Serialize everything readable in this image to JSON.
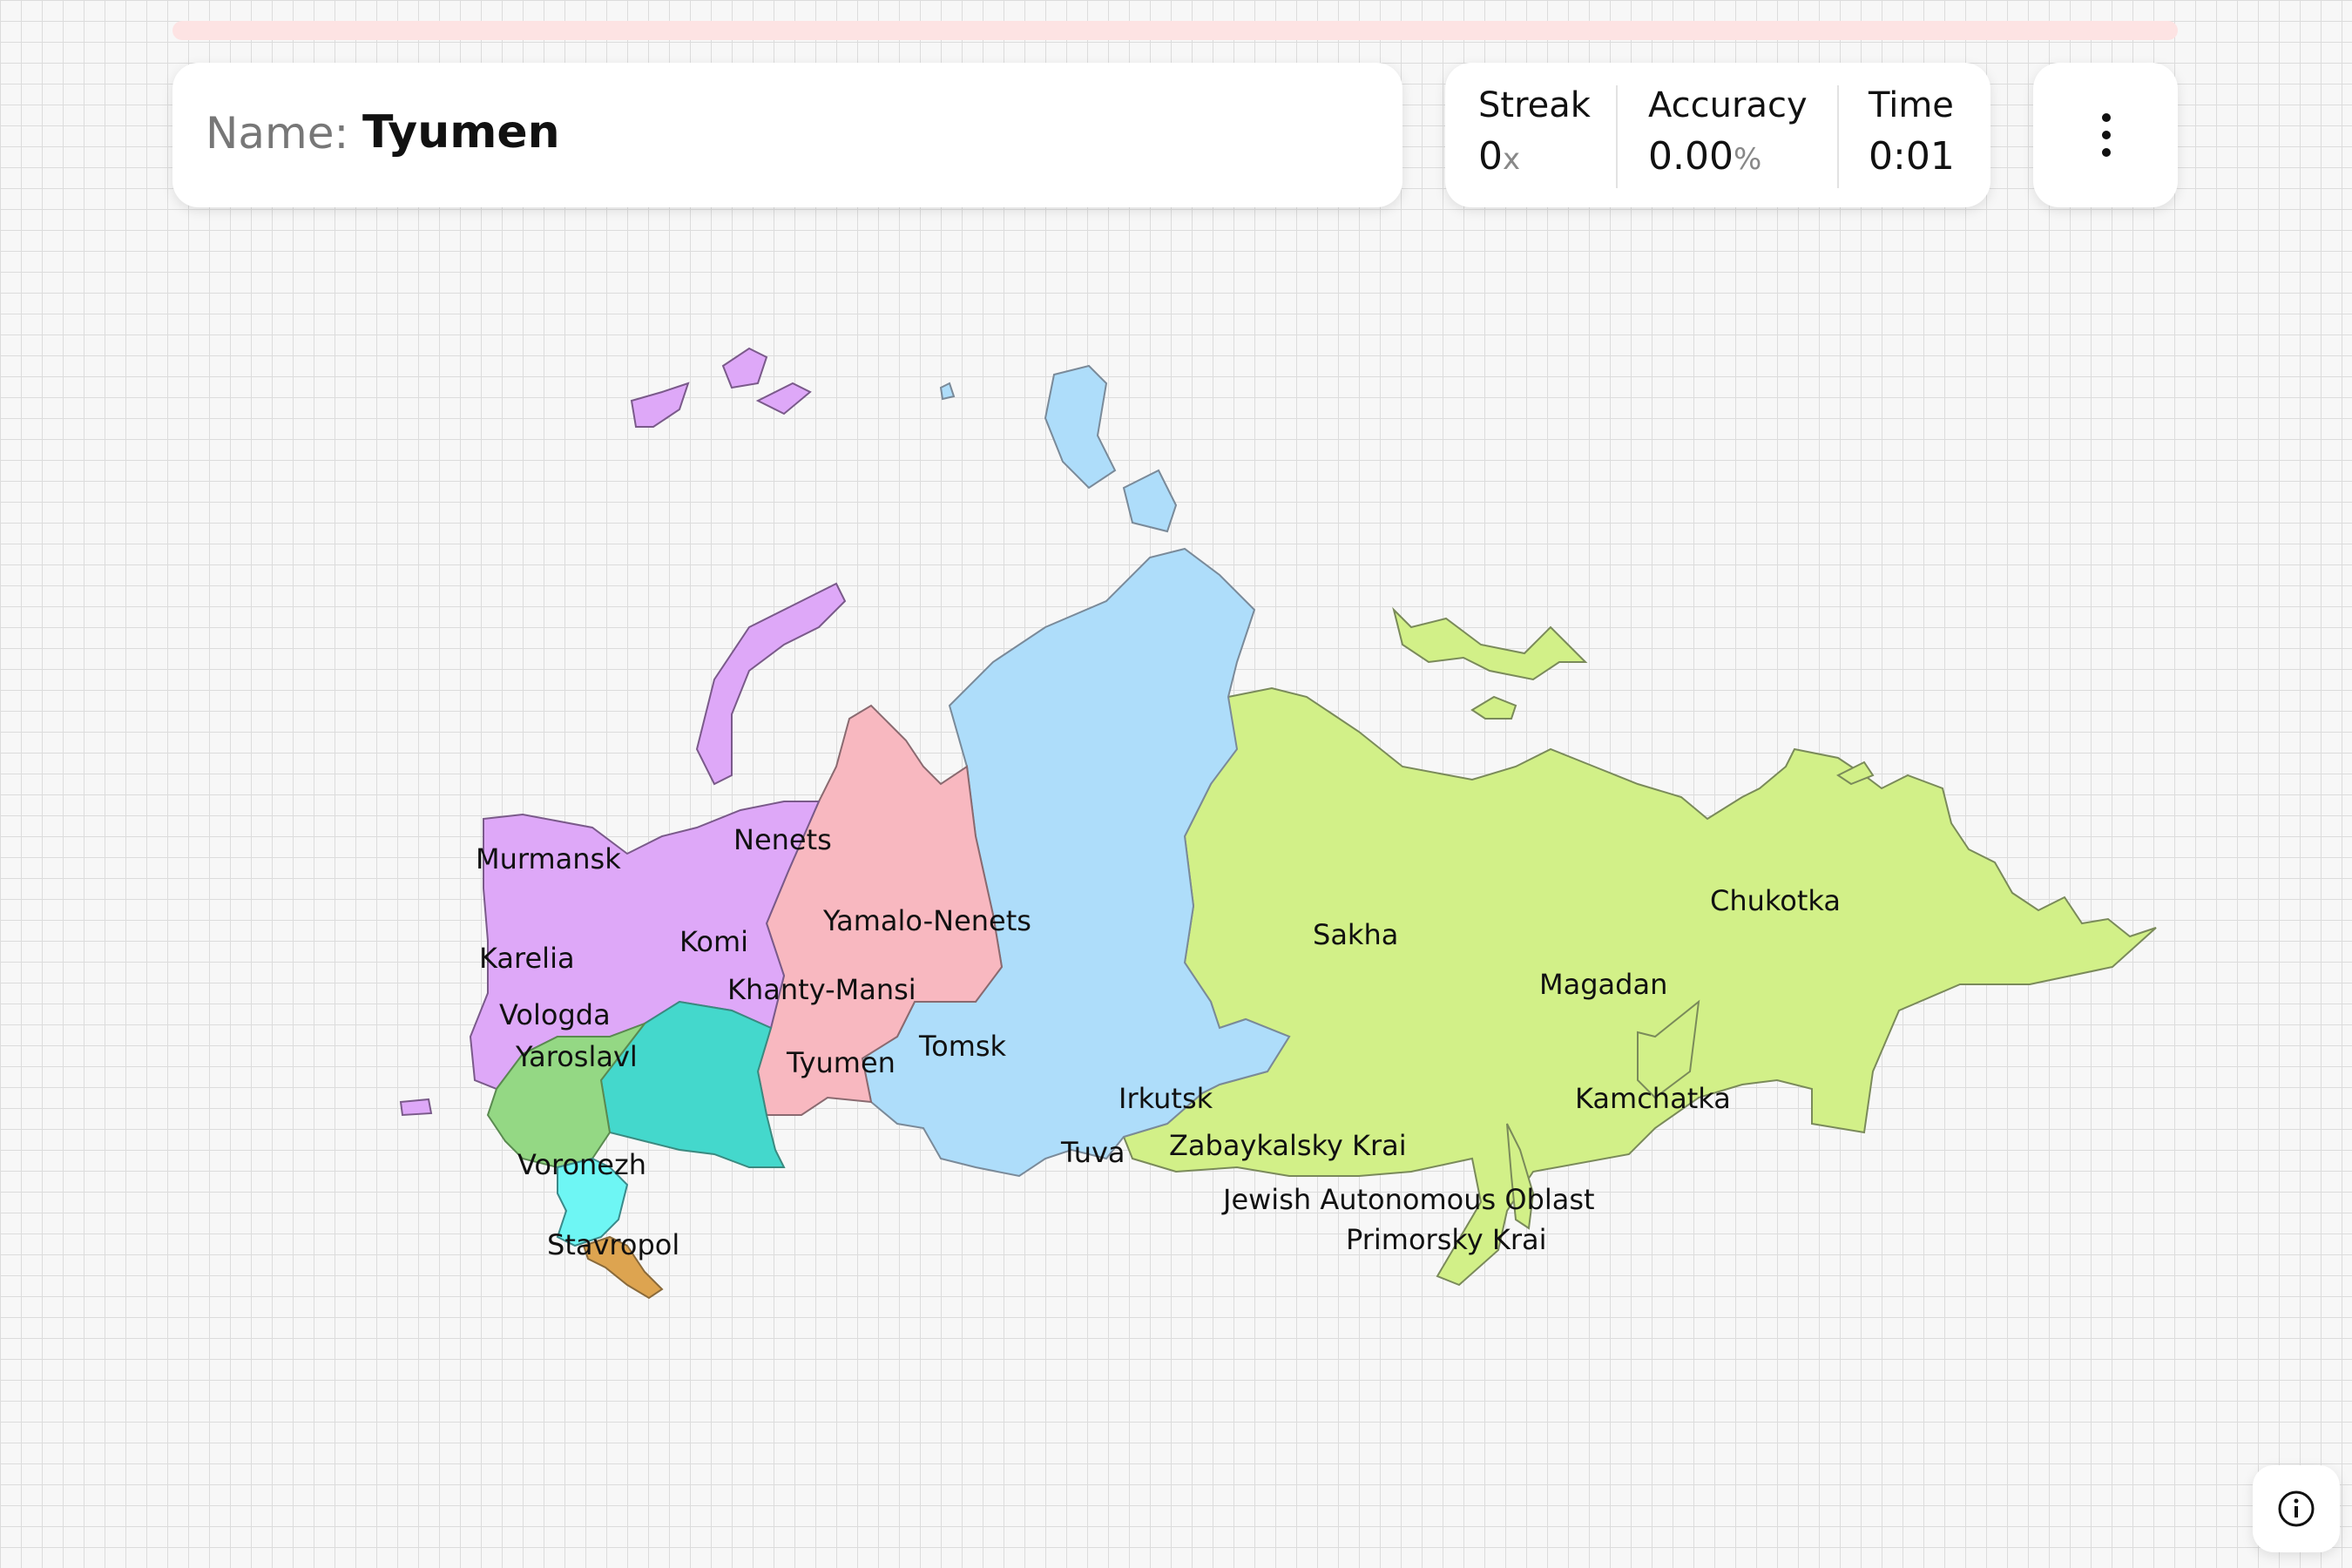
{
  "header": {
    "progress_percent": 0,
    "name_label": "Name:",
    "name_value": "Tyumen"
  },
  "stats": {
    "streak": {
      "title": "Streak",
      "value": "0",
      "unit": "x"
    },
    "accuracy": {
      "title": "Accuracy",
      "value": "0.00",
      "unit": "%"
    },
    "time": {
      "title": "Time",
      "value": "0:01"
    }
  },
  "menu": {
    "icon": "more-vertical-icon"
  },
  "info": {
    "icon": "info-icon"
  },
  "colors": {
    "northwest": "#dea8f8",
    "ural": "#f8b8c0",
    "siberia": "#aeddfa",
    "far_east": "#d2f088",
    "central": "#94d884",
    "volga": "#44d8cc",
    "south": "#6ef6f4",
    "caucasus": "#dda450",
    "track": "#fde3e3"
  },
  "map": {
    "labels": [
      "Murmansk",
      "Nenets",
      "Karelia",
      "Komi",
      "Yamalo-Nenets",
      "Khanty-Mansi",
      "Vologda",
      "Yaroslavl",
      "Tyumen",
      "Tomsk",
      "Voronezh",
      "Stavropol",
      "Sakha",
      "Chukotka",
      "Magadan",
      "Kamchatka",
      "Irkutsk",
      "Tuva",
      "Zabaykalsky Krai",
      "Jewish Autonomous Oblast",
      "Primorsky Krai"
    ]
  }
}
